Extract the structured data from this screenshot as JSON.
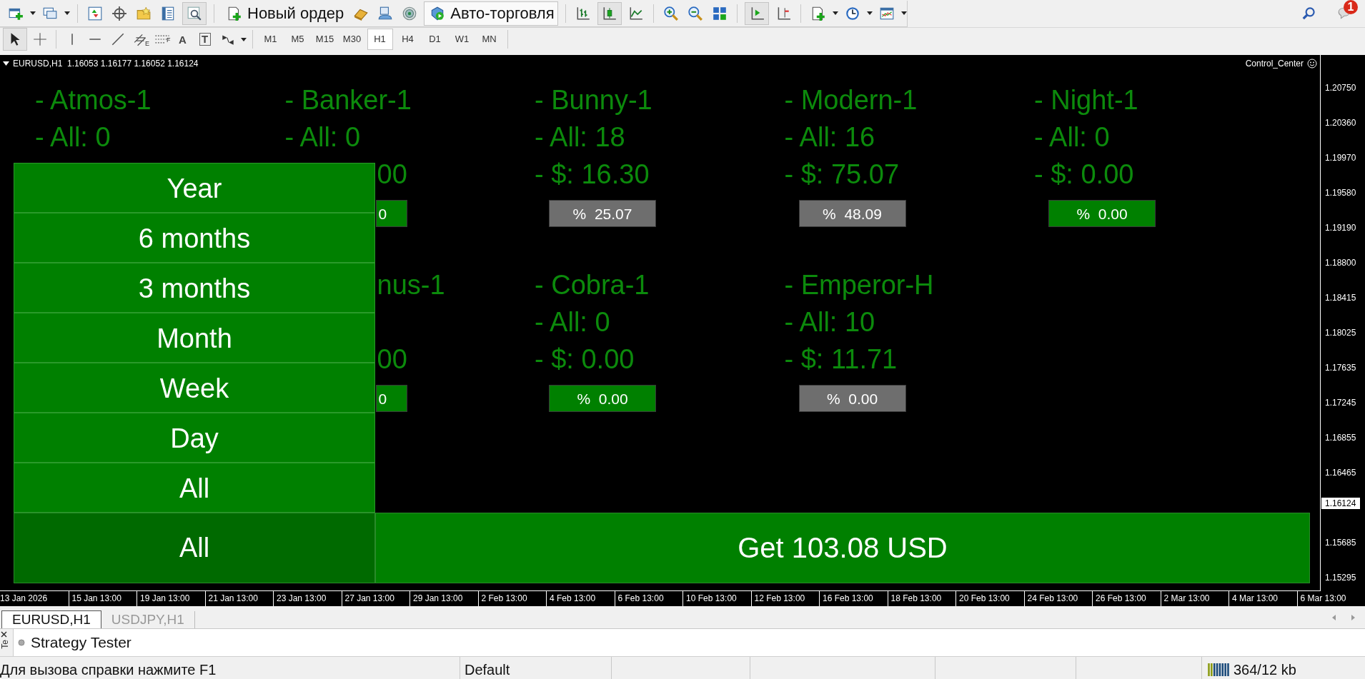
{
  "toolbar": {
    "order_button": "Новый ордер",
    "autotrading_button": "Авто-торговля",
    "notification_count": "1"
  },
  "drawing_toolbar": {
    "channel_mark": "E",
    "fibo_mark": "F",
    "text_tool": "A",
    "label_tool": "T",
    "timeframes": [
      {
        "label": "M1",
        "selected": false
      },
      {
        "label": "M5",
        "selected": false
      },
      {
        "label": "M15",
        "selected": false
      },
      {
        "label": "M30",
        "selected": false
      },
      {
        "label": "H1",
        "selected": true
      },
      {
        "label": "H4",
        "selected": false
      },
      {
        "label": "D1",
        "selected": false
      },
      {
        "label": "W1",
        "selected": false
      },
      {
        "label": "MN",
        "selected": false
      }
    ]
  },
  "chart": {
    "header": "EURUSD,H1  1.16053 1.16177 1.16052 1.16124",
    "indicator_name": "Control_Center",
    "price_axis": [
      "1.20750",
      "1.20360",
      "1.19970",
      "1.19580",
      "1.19190",
      "1.18800",
      "1.18415",
      "1.18025",
      "1.17635",
      "1.17245",
      "1.16855",
      "1.16465",
      "1.15685",
      "1.15295"
    ],
    "current_price": "1.16124",
    "time_axis": [
      "13 Jan 2026",
      "15 Jan 13:00",
      "19 Jan 13:00",
      "21 Jan 13:00",
      "23 Jan 13:00",
      "27 Jan 13:00",
      "29 Jan 13:00",
      "2 Feb 13:00",
      "4 Feb 13:00",
      "6 Feb 13:00",
      "10 Feb 13:00",
      "12 Feb 13:00",
      "16 Feb 13:00",
      "18 Feb 13:00",
      "20 Feb 13:00",
      "24 Feb 13:00",
      "26 Feb 13:00",
      "2 Mar 13:00",
      "4 Mar 13:00",
      "6 Mar 13:00"
    ],
    "dashboard": {
      "rows": [
        {
          "bots": [
            {
              "kind": "partial",
              "name": "- Atmos-1",
              "all": "- All: 0"
            },
            {
              "kind": "partial",
              "name": "- Banker-1",
              "all": "- All: 0",
              "money": "00",
              "percent": {
                "text": "0",
                "color": "#008000"
              }
            },
            {
              "kind": "bot",
              "name": "- Bunny-1",
              "all": "- All: 18",
              "money": "- $: 16.30",
              "percent": {
                "text": "%  25.07",
                "color": "#6e6e6e"
              }
            },
            {
              "kind": "bot",
              "name": "- Modern-1",
              "all": "- All: 16",
              "money": "- $: 75.07",
              "percent": {
                "text": "%  48.09",
                "color": "#6e6e6e"
              }
            },
            {
              "kind": "bot",
              "name": "- Night-1",
              "all": "- All: 0",
              "money": "- $: 0.00",
              "percent": {
                "text": "%  0.00",
                "color": "#008000"
              }
            }
          ]
        },
        {
          "bots": [
            {
              "kind": "covered"
            },
            {
              "kind": "partial",
              "name": "nus-1",
              "money": "00",
              "percent": {
                "text": "0",
                "color": "#008000"
              }
            },
            {
              "kind": "bot",
              "name": "- Cobra-1",
              "all": "- All: 0",
              "money": "- $: 0.00",
              "percent": {
                "text": "%  0.00",
                "color": "#008000"
              }
            },
            {
              "kind": "bot",
              "name": "- Emperor-H",
              "all": "- All: 10",
              "money": "- $: 11.71",
              "percent": {
                "text": "%  0.00",
                "color": "#6e6e6e"
              }
            }
          ]
        }
      ]
    },
    "period_menu": [
      {
        "label": "Year",
        "selected": false
      },
      {
        "label": "6 months",
        "selected": false
      },
      {
        "label": "3 months",
        "selected": false
      },
      {
        "label": "Month",
        "selected": false
      },
      {
        "label": "Week",
        "selected": false
      },
      {
        "label": "Day",
        "selected": false
      },
      {
        "label": "All",
        "selected": false
      }
    ],
    "period_select": "All",
    "total_button": "Get 103.08 USD"
  },
  "chart_tabs": [
    {
      "label": "EURUSD,H1",
      "selected": true
    },
    {
      "label": "USDJPY,H1",
      "selected": false
    }
  ],
  "tester_panel": {
    "side_label": "Te",
    "title": "Strategy Tester"
  },
  "status_bar": {
    "help": "Для вызова справки нажмите F1",
    "profile": "Default",
    "traffic": "364/12 kb"
  }
}
